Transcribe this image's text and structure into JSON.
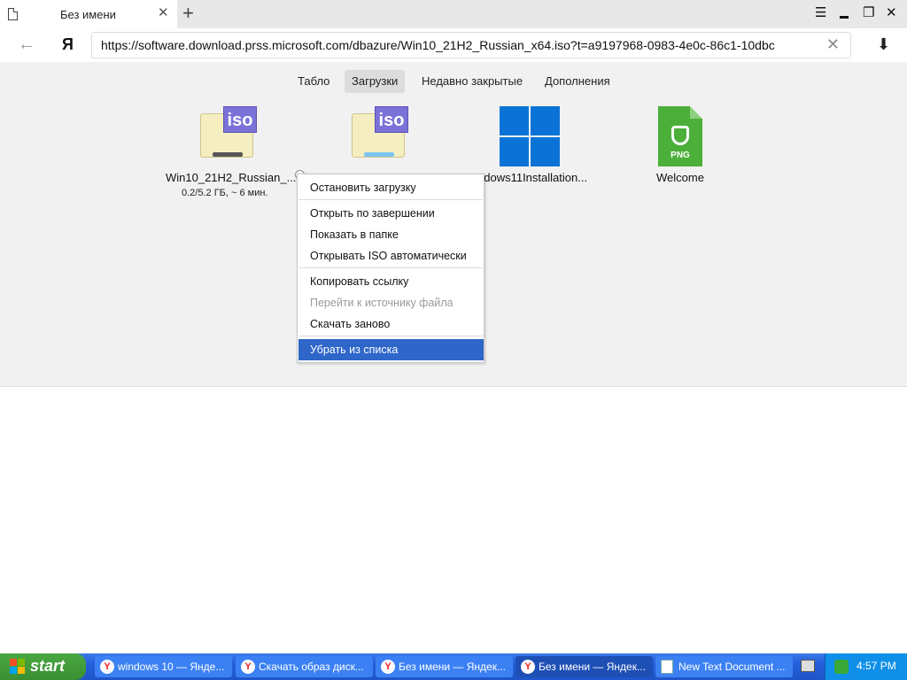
{
  "browser": {
    "tab_title": "Без имени",
    "tab_close": "✕",
    "new_tab": "+",
    "url": "https://software.download.prss.microsoft.com/dbazure/Win10_21H2_Russian_x64.iso?t=a9197968-0983-4e0c-86c1-10dbc",
    "yandex_logo": "Я",
    "back": "←",
    "url_clear": "✕",
    "download": "⬇",
    "window_controls": {
      "menu": "☰",
      "minimize": "▬",
      "restore": "❐",
      "close": "✕"
    }
  },
  "page_tabs": [
    "Табло",
    "Загрузки",
    "Недавно закрытые",
    "Дополнения"
  ],
  "downloads": [
    {
      "name": "Win10_21H2_Russian_...",
      "progress": "0.2/5.2 ГБ, ~ 6 мин.",
      "icon": "iso-icon",
      "badge": "iso"
    },
    {
      "name": "",
      "progress": "",
      "icon": "iso-icon",
      "badge": "iso"
    },
    {
      "name": "ndows11Installation...",
      "progress": "",
      "icon": "windows-logo-icon"
    },
    {
      "name": "Welcome",
      "progress": "",
      "icon": "png-icon",
      "badge": "PNG"
    }
  ],
  "context_menu": {
    "items": [
      {
        "label": "Остановить загрузку",
        "enabled": true
      },
      {
        "label": "Открыть по завершении",
        "enabled": true
      },
      {
        "label": "Показать в папке",
        "enabled": true
      },
      {
        "label": "Открывать ISO автоматически",
        "enabled": true
      },
      {
        "label": "Копировать ссылку",
        "enabled": true
      },
      {
        "label": "Перейти к источнику файла",
        "enabled": false
      },
      {
        "label": "Скачать заново",
        "enabled": true
      },
      {
        "label": "Убрать из списка",
        "enabled": true,
        "highlighted": true
      }
    ]
  },
  "taskbar": {
    "start_label": "start",
    "tasks": [
      {
        "label": "windows 10 — Яндe...",
        "icon": "yandex-browser-icon"
      },
      {
        "label": "Скачать образ диск...",
        "icon": "yandex-browser-icon"
      },
      {
        "label": "Без имени — Яндек...",
        "icon": "yandex-browser-icon"
      },
      {
        "label": "Без имени — Яндек...",
        "icon": "yandex-browser-icon",
        "active": true
      },
      {
        "label": "New Text Document ...",
        "icon": "notepad-icon"
      }
    ],
    "clock": "4:57 PM"
  },
  "colors": {
    "menu_highlight": "#2e66c9",
    "iso_badge": "#7b72d8",
    "windows_blue": "#0b73d6",
    "png_green": "#4caf3a",
    "taskbar_blue": "#245edb",
    "start_green": "#3a8f33"
  }
}
